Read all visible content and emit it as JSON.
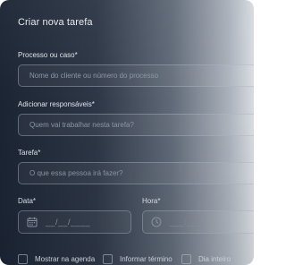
{
  "dialog": {
    "title": "Criar nova tarefa"
  },
  "fields": {
    "process": {
      "label": "Processo ou caso*",
      "placeholder": "Nome do cliente ou número do processo"
    },
    "assignees": {
      "label": "Adicionar responsáveis*",
      "placeholder": "Quem vai trabalhar nesta tarefa?"
    },
    "task": {
      "label": "Tarefa*",
      "placeholder": "O que essa pessoa irá fazer?"
    },
    "date": {
      "label": "Data*",
      "placeholder": "__/__/____",
      "icon": "calendar-icon"
    },
    "time": {
      "label": "Hora*",
      "placeholder": "___:___",
      "icon": "clock-icon"
    }
  },
  "options": [
    {
      "label": "Mostrar na agenda"
    },
    {
      "label": "Informar término"
    },
    {
      "label": "Dia inteiro"
    }
  ],
  "colors": {
    "panel_dark": "#1b2433",
    "panel_light": "#d8dce1",
    "text": "#e7eaee",
    "placeholder": "#8c96a4"
  }
}
